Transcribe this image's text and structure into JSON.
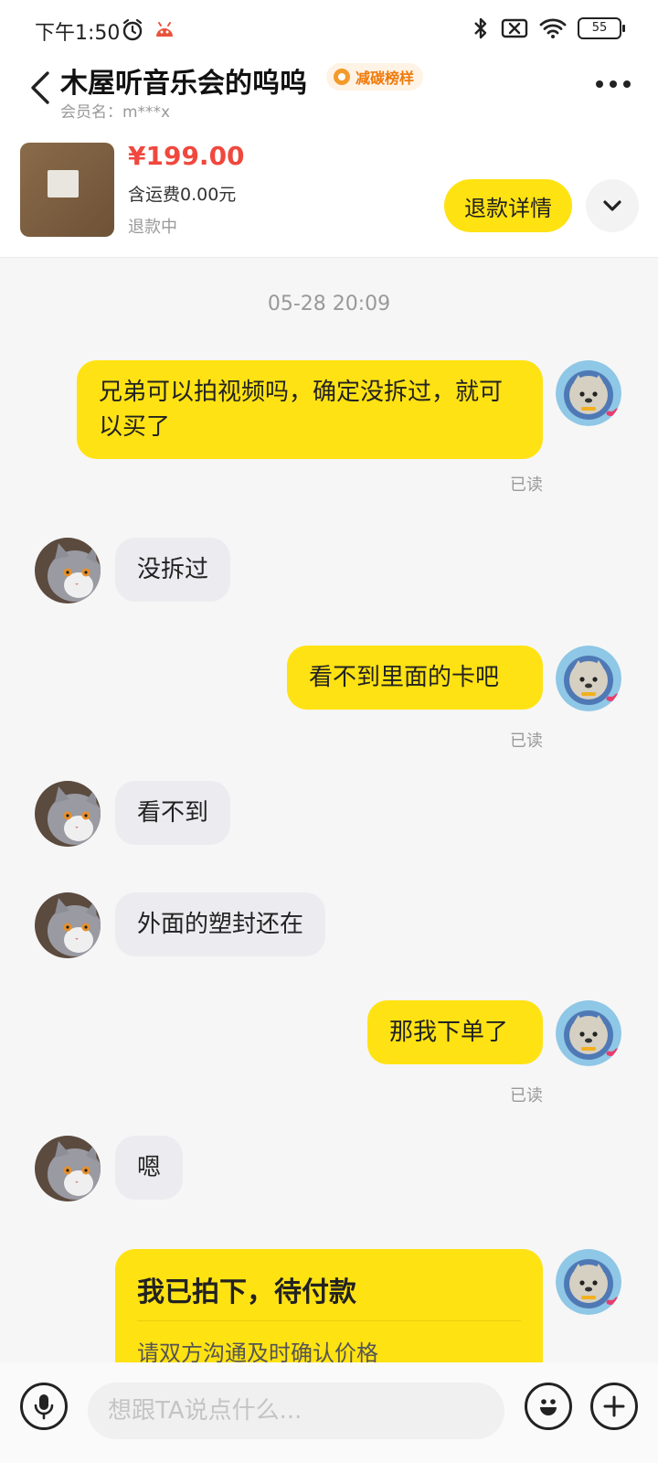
{
  "status_bar": {
    "time": "下午1:50",
    "battery": "55",
    "icons": [
      "alarm-icon",
      "app-notification-icon",
      "bluetooth-icon",
      "no-sim-icon",
      "wifi-icon",
      "battery-icon"
    ]
  },
  "header": {
    "title": "木屋听音乐会的呜呜",
    "badge": "减碳榜样",
    "member": "会员名：m***x"
  },
  "product": {
    "price": "¥199.00",
    "shipping": "含运费0.00元",
    "status": "退款中",
    "refund_button": "退款详情"
  },
  "chat": {
    "timestamp": "05-28 20:09",
    "messages": [
      {
        "side": "me",
        "text": "兄弟可以拍视频吗，确定没拆过，就可以买了",
        "read": "已读"
      },
      {
        "side": "them",
        "text": "没拆过"
      },
      {
        "side": "me",
        "text": "看不到里面的卡吧",
        "read": "已读"
      },
      {
        "side": "them",
        "text": "看不到"
      },
      {
        "side": "them",
        "text": "外面的塑封还在"
      },
      {
        "side": "me",
        "text": "那我下单了",
        "read": "已读"
      },
      {
        "side": "them",
        "text": "嗯"
      }
    ],
    "order_card": {
      "title": "我已拍下，待付款",
      "subtitle": "请双方沟通及时确认价格"
    }
  },
  "input": {
    "placeholder": "想跟TA说点什么..."
  },
  "colors": {
    "accent_yellow": "#ffe212",
    "price_red": "#f0483e",
    "badge_orange": "#ee7a0c"
  }
}
